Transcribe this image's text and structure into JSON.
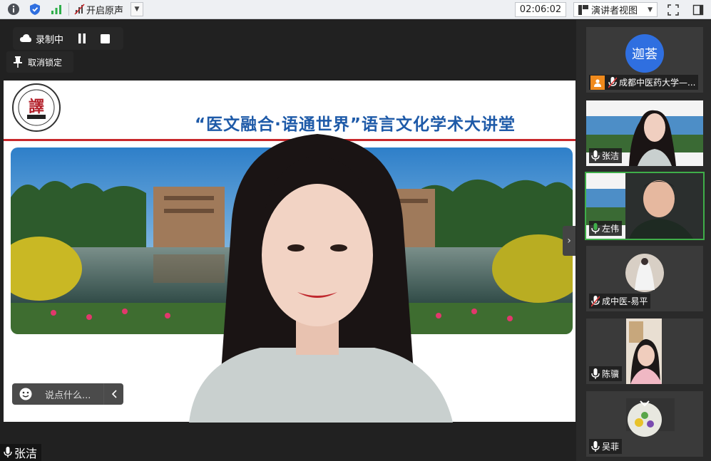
{
  "toolbar": {
    "original_sound_label": "开启原声",
    "timer": "02:06:02",
    "view_mode_label": "演讲者视图"
  },
  "recording": {
    "status_label": "录制中",
    "unpin_label": "取消锁定"
  },
  "slide": {
    "title": "“医文融合·语通世界”语言文化学术大讲堂",
    "logo_text": "譯"
  },
  "chat": {
    "placeholder": "说点什么..."
  },
  "active_speaker": {
    "name": "张洁"
  },
  "participants": [
    {
      "name": "成都中医药大学—...",
      "avatar_text": "迦荟",
      "is_host": true,
      "mic": "muted"
    },
    {
      "name": "张洁",
      "mic": "on"
    },
    {
      "name": "左伟",
      "mic": "speaking"
    },
    {
      "name": "成中医-易平",
      "mic": "muted"
    },
    {
      "name": "陈骥",
      "mic": "on"
    },
    {
      "name": "吴菲",
      "mic": "on"
    }
  ],
  "colors": {
    "title_blue": "#1e5aa8",
    "accent_red": "#c9272b",
    "speaking_green": "#3fae49",
    "host_orange": "#f08a1c"
  }
}
